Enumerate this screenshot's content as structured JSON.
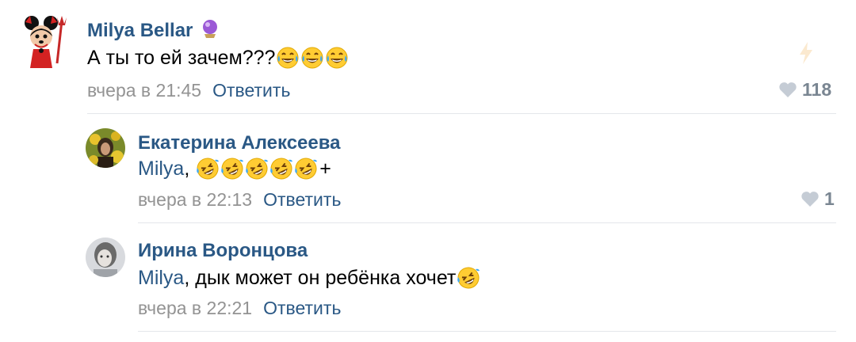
{
  "comments": [
    {
      "author": "Milya Bellar",
      "text": "А ты то ей зачем???",
      "emojis": [
        "face-with-tears-of-joy",
        "face-with-tears-of-joy",
        "face-with-tears-of-joy"
      ],
      "time": "вчера в 21:45",
      "reply_label": "Ответить",
      "likes": "118"
    },
    {
      "author": "Екатерина Алексеева",
      "mention": "Milya",
      "text_after_mention": ", ",
      "emojis": [
        "rolling-on-floor-laughing",
        "rolling-on-floor-laughing",
        "rolling-on-floor-laughing",
        "rolling-on-floor-laughing",
        "rolling-on-floor-laughing"
      ],
      "text_suffix": "+",
      "time": "вчера в 22:13",
      "reply_label": "Ответить",
      "likes": "1"
    },
    {
      "author": "Ирина Воронцова",
      "mention": "Milya",
      "text_after_mention": ", дык может он ребёнка хочет",
      "emojis": [
        "rolling-on-floor-laughing"
      ],
      "time": "вчера в 22:21",
      "reply_label": "Ответить"
    }
  ],
  "colors": {
    "link": "#2a5885",
    "meta": "#939393",
    "like_icon": "#c5ccd5",
    "like_count": "#7a8692",
    "divider": "#e4e6ea"
  },
  "icons": {
    "author_badge": "crystal-ball-icon",
    "like": "heart-icon",
    "repost_hint": "lightning-icon"
  }
}
